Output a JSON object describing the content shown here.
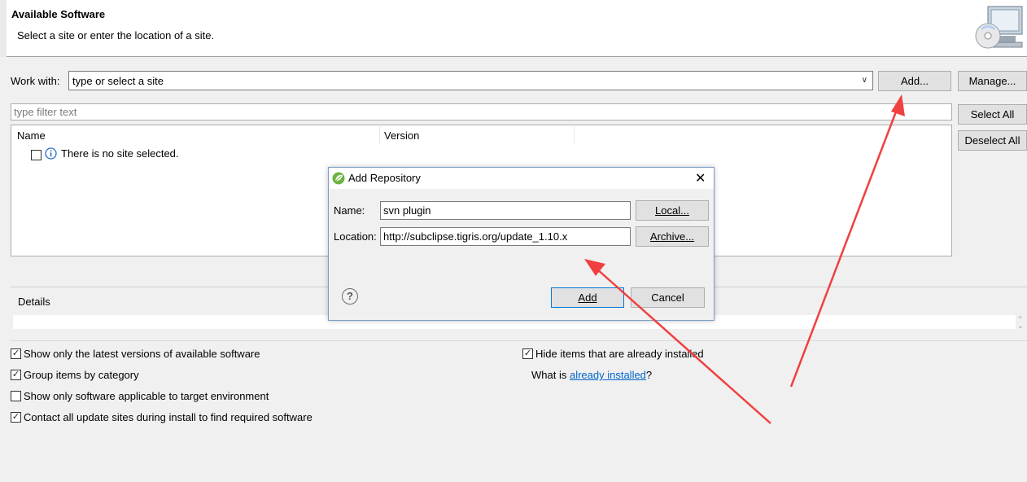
{
  "header": {
    "title": "Available Software",
    "description": "Select a site or enter the location of a site."
  },
  "work_with": {
    "label": "Work with:",
    "value": "type or select a site",
    "add_button": "Add...",
    "manage_button": "Manage..."
  },
  "filter": {
    "placeholder": "type filter text"
  },
  "buttons": {
    "select_all": "Select All",
    "deselect_all": "Deselect All"
  },
  "table": {
    "columns": [
      "Name",
      "Version"
    ],
    "rows": [
      {
        "checked": false,
        "text": "There is no site selected."
      }
    ]
  },
  "details": {
    "label": "Details"
  },
  "options": {
    "show_latest": {
      "label": "Show only the latest versions of available software",
      "checked": true
    },
    "group_by_category": {
      "label": "Group items by category",
      "checked": true
    },
    "show_applicable": {
      "label": "Show only software applicable to target environment",
      "checked": false
    },
    "contact_all": {
      "label": "Contact all update sites during install to find required software",
      "checked": true
    },
    "hide_installed": {
      "label": "Hide items that are already installed",
      "checked": true
    },
    "what_is_prefix": "What is ",
    "what_is_link": "already installed",
    "what_is_suffix": "?"
  },
  "dialog": {
    "title": "Add Repository",
    "name_label": "Name:",
    "name_value": "svn plugin",
    "location_label": "Location:",
    "location_value": "http://subclipse.tigris.org/update_1.10.x",
    "local_button": "Local...",
    "archive_button": "Archive...",
    "add_button": "Add",
    "cancel_button": "Cancel",
    "close_glyph": "✕",
    "help_glyph": "?"
  },
  "colors": {
    "arrow": "#f04040",
    "link": "#0066cc",
    "dialog_border": "#7a9dc9"
  }
}
